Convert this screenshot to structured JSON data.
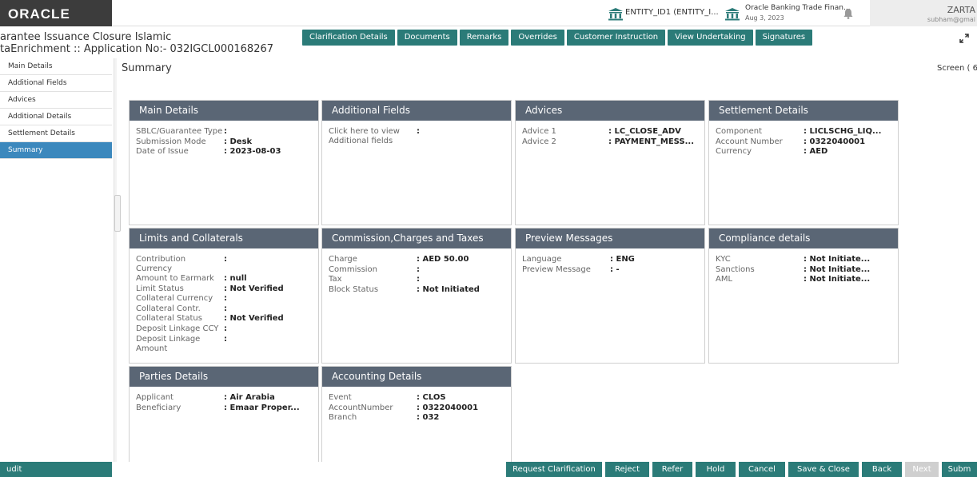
{
  "topbar": {
    "logo": "ORACLE",
    "entity": "ENTITY_ID1 (ENTITY_I...",
    "app_title": "Oracle Banking Trade Finan...",
    "app_date": "Aug 3, 2023",
    "user_name": "ZARTA",
    "user_email": "subham@gmai",
    "icons": [
      "bank-icon",
      "bell-icon"
    ]
  },
  "header": {
    "title": "arantee Issuance Closure Islamic",
    "subtitle": "taEnrichment :: Application No:- 032IGCL000168267",
    "tabs": [
      "Clarification Details",
      "Documents",
      "Remarks",
      "Overrides",
      "Customer Instruction",
      "View Undertaking",
      "Signatures"
    ]
  },
  "sidebar": {
    "items": [
      {
        "label": "Main Details",
        "active": false
      },
      {
        "label": "Additional Fields",
        "active": false
      },
      {
        "label": "Advices",
        "active": false
      },
      {
        "label": "Additional Details",
        "active": false
      },
      {
        "label": "Settlement Details",
        "active": false
      },
      {
        "label": "Summary",
        "active": true
      }
    ]
  },
  "main": {
    "title": "Summary",
    "screen_label": "Screen ( 6"
  },
  "cards": {
    "main_details": {
      "title": "Main Details",
      "rows": [
        {
          "label": "SBLC/Guarantee Type",
          "value": ""
        },
        {
          "label": "Submission Mode",
          "value": "Desk"
        },
        {
          "label": "Date of Issue",
          "value": "2023-08-03"
        }
      ]
    },
    "additional_fields": {
      "title": "Additional Fields",
      "rows": [
        {
          "label": "Click here to view Additional fields",
          "value": ""
        }
      ]
    },
    "advices": {
      "title": "Advices",
      "rows": [
        {
          "label": "Advice 1",
          "value": "LC_CLOSE_ADV"
        },
        {
          "label": "Advice 2",
          "value": "PAYMENT_MESS..."
        }
      ]
    },
    "settlement_details": {
      "title": "Settlement Details",
      "rows": [
        {
          "label": "Component",
          "value": "LICLSCHG_LIQ..."
        },
        {
          "label": "Account Number",
          "value": "0322040001"
        },
        {
          "label": "Currency",
          "value": "AED"
        }
      ]
    },
    "limits_collaterals": {
      "title": "Limits and Collaterals",
      "rows": [
        {
          "label": "Contribution Currency",
          "value": ""
        },
        {
          "label": "Amount to Earmark",
          "value": "null"
        },
        {
          "label": "Limit Status",
          "value": "Not Verified"
        },
        {
          "label": "Collateral Currency",
          "value": ""
        },
        {
          "label": "Collateral Contr.",
          "value": ""
        },
        {
          "label": "Collateral Status",
          "value": "Not Verified"
        },
        {
          "label": "Deposit Linkage CCY",
          "value": ""
        },
        {
          "label": "Deposit Linkage Amount",
          "value": ""
        }
      ]
    },
    "commission": {
      "title": "Commission,Charges and Taxes",
      "rows": [
        {
          "label": "Charge",
          "value": "AED  50.00"
        },
        {
          "label": "Commission",
          "value": ""
        },
        {
          "label": "Tax",
          "value": ""
        },
        {
          "label": "Block Status",
          "value": "Not Initiated"
        }
      ]
    },
    "preview_messages": {
      "title": "Preview Messages",
      "rows": [
        {
          "label": "Language",
          "value": "ENG"
        },
        {
          "label": "Preview Message",
          "value": "-"
        }
      ]
    },
    "compliance": {
      "title": "Compliance details",
      "rows": [
        {
          "label": "KYC",
          "value": "Not Initiate..."
        },
        {
          "label": "Sanctions",
          "value": "Not Initiate..."
        },
        {
          "label": "AML",
          "value": "Not Initiate..."
        }
      ]
    },
    "parties": {
      "title": "Parties Details",
      "rows": [
        {
          "label": "Applicant",
          "value": "Air Arabia"
        },
        {
          "label": "Beneficiary",
          "value": "Emaar Proper..."
        }
      ]
    },
    "accounting": {
      "title": "Accounting Details",
      "rows": [
        {
          "label": "Event",
          "value": "CLOS"
        },
        {
          "label": "AccountNumber",
          "value": "0322040001"
        },
        {
          "label": "Branch",
          "value": "032"
        }
      ]
    }
  },
  "footer": {
    "audit": "udit",
    "buttons": [
      "Request Clarification",
      "Reject",
      "Refer",
      "Hold",
      "Cancel",
      "Save & Close",
      "Back",
      "Next",
      "Subm"
    ]
  },
  "colors": {
    "teal": "#2b7b78",
    "card_header": "#5a6675",
    "active_nav": "#3c88bd",
    "logo_bg": "#3c3c3c",
    "disabled": "#cfcfcf"
  }
}
